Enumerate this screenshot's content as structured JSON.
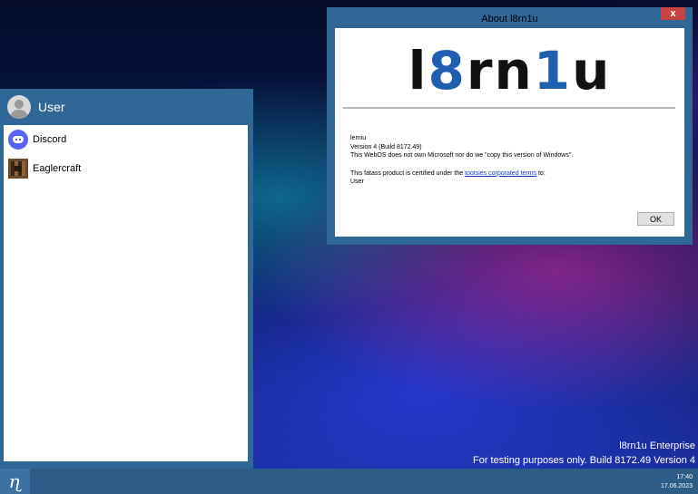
{
  "start_menu": {
    "user_name": "User",
    "apps": [
      {
        "label": "Discord",
        "icon": "discord-icon"
      },
      {
        "label": "Eaglercraft",
        "icon": "eaglercraft-icon"
      }
    ]
  },
  "about_dialog": {
    "title": "About l8rn1u",
    "close_label": "x",
    "logo": {
      "part1": "l",
      "part2": "8",
      "part3": "rn",
      "part4": "1",
      "part5": "u"
    },
    "product_name": "lerniu",
    "version": "Version 4 (Build 8172.49)",
    "disclaimer": "This WebOS does not own Microsoft nor do we \"copy this version of Windows\".",
    "license_prefix": "This fatass product is certified under the ",
    "license_link": "tootsies corporated terms",
    "license_suffix": " to:",
    "licensed_user": "User",
    "ok_label": "OK"
  },
  "watermark": {
    "line1": "l8rn1u Enterprise",
    "line2": "For testing purposes only. Build 8172.49 Version 4"
  },
  "taskbar": {
    "start_glyph": "ɳ",
    "time": "17:40",
    "date": "17.06.2023"
  },
  "colors": {
    "window_frame": "#2f6797",
    "close_button": "#c74343",
    "logo_blue": "#1f5fb0",
    "taskbar": "#2c5d87"
  }
}
